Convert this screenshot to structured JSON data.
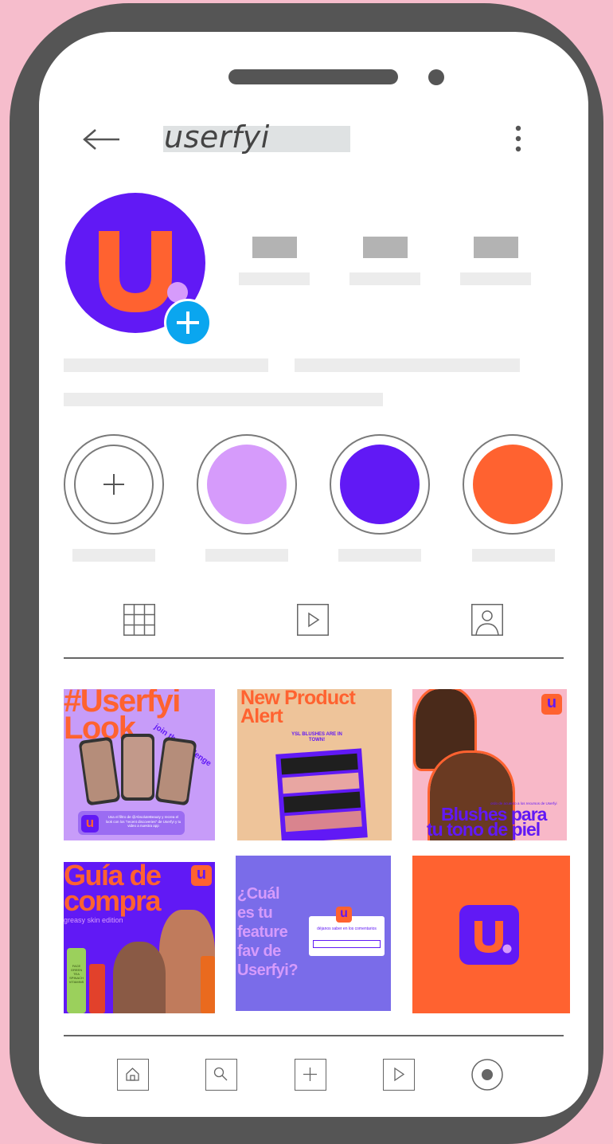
{
  "profile": {
    "username": "userfyi"
  },
  "colors": {
    "brand_purple": "#6119f5",
    "brand_orange": "#ff6230",
    "lilac": "#d69bfb",
    "badge_blue": "#0aa6ef"
  },
  "icons": {
    "back": "arrow-left-icon",
    "more": "more-vertical-icon",
    "add": "plus-icon",
    "grid": "grid-icon",
    "reels": "play-icon",
    "tagged": "user-icon",
    "home": "home-icon",
    "search": "search-icon",
    "create": "plus-icon",
    "video": "play-icon",
    "profile": "circle-dot-icon"
  },
  "posts": [
    {
      "title1": "#Userfyi",
      "title2": "Look",
      "tag": "join the challenge",
      "caption": "Usa el filtro de @AbsoluteBeauty y recrea el look con los \"recent discoveries\" de Userfyi y tu video a nuestra app"
    },
    {
      "title1": "New Product",
      "title2": "Alert",
      "subtitle": "YSL BLUSHES ARE IN TOWN!"
    },
    {
      "small": "ordo de acuerdo a los recursos de Userfyi",
      "title1": "Blushes para",
      "title2": "tu tono de piel"
    },
    {
      "title1": "Guía de",
      "title2": "compra",
      "subtitle": "greasy skin edition",
      "product": "FACE GREEN TEA SPINACH VITAMINS"
    },
    {
      "q1": "¿Cuál",
      "q2": "es tu",
      "q3": "feature",
      "q4": "fav de",
      "q5": "Userfyi?",
      "card": "déjanos saber en los comentarios"
    },
    {}
  ],
  "logo_letter": "u"
}
